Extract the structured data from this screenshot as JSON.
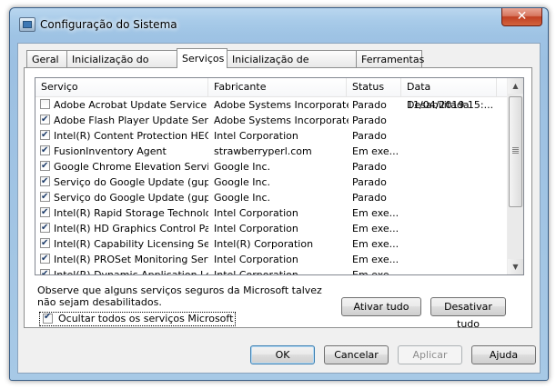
{
  "window": {
    "title": "Configuração do Sistema",
    "close_glyph": "✕"
  },
  "tabs": [
    {
      "label": "Geral",
      "active": false
    },
    {
      "label": "Inicialização do Sistema",
      "active": false
    },
    {
      "label": "Serviços",
      "active": true
    },
    {
      "label": "Inicialização de Programas",
      "active": false
    },
    {
      "label": "Ferramentas",
      "active": false
    }
  ],
  "services": {
    "columns": [
      "Serviço",
      "Fabricante",
      "Status",
      "Data Desabilitada"
    ],
    "rows": [
      {
        "checked": false,
        "name": "Adobe Acrobat Update Service",
        "manufacturer": "Adobe Systems Incorporated",
        "status": "Parado",
        "disabled_date": "11/04/2019 15:..."
      },
      {
        "checked": true,
        "name": "Adobe Flash Player Update Service",
        "manufacturer": "Adobe Systems Incorporated",
        "status": "Parado",
        "disabled_date": ""
      },
      {
        "checked": true,
        "name": "Intel(R) Content Protection HEC...",
        "manufacturer": "Intel Corporation",
        "status": "Parado",
        "disabled_date": ""
      },
      {
        "checked": true,
        "name": "FusionInventory Agent",
        "manufacturer": "strawberryperl.com",
        "status": "Em exe...",
        "disabled_date": ""
      },
      {
        "checked": true,
        "name": "Google Chrome Elevation Service",
        "manufacturer": "Google Inc.",
        "status": "Parado",
        "disabled_date": ""
      },
      {
        "checked": true,
        "name": "Serviço do Google Update (gupd...",
        "manufacturer": "Google Inc.",
        "status": "Parado",
        "disabled_date": ""
      },
      {
        "checked": true,
        "name": "Serviço do Google Update (gupd...",
        "manufacturer": "Google Inc.",
        "status": "Parado",
        "disabled_date": ""
      },
      {
        "checked": true,
        "name": "Intel(R) Rapid Storage Technology",
        "manufacturer": "Intel Corporation",
        "status": "Em exe...",
        "disabled_date": ""
      },
      {
        "checked": true,
        "name": "Intel(R) HD Graphics Control Pa...",
        "manufacturer": "Intel Corporation",
        "status": "Em exe...",
        "disabled_date": ""
      },
      {
        "checked": true,
        "name": "Intel(R) Capability Licensing Ser...",
        "manufacturer": "Intel(R) Corporation",
        "status": "Em exe...",
        "disabled_date": ""
      },
      {
        "checked": true,
        "name": "Intel(R) PROSet Monitoring Service",
        "manufacturer": "Intel Corporation",
        "status": "Em exe...",
        "disabled_date": ""
      },
      {
        "checked": true,
        "name": "Intel(R) Dynamic Application Loa...",
        "manufacturer": "Intel Corporation",
        "status": "Em exe...",
        "disabled_date": ""
      }
    ]
  },
  "note": "Observe que alguns serviços seguros da Microsoft talvez não sejam desabilitados.",
  "buttons": {
    "enable_all": "Ativar tudo",
    "disable_all": "Desativar tudo",
    "ok": "OK",
    "cancel": "Cancelar",
    "apply": "Aplicar",
    "help": "Ajuda"
  },
  "hide_microsoft": {
    "label": "Ocultar todos os serviços Microsoft",
    "checked": true
  },
  "scrollbar": {
    "up_glyph": "▲",
    "down_glyph": "▼"
  }
}
